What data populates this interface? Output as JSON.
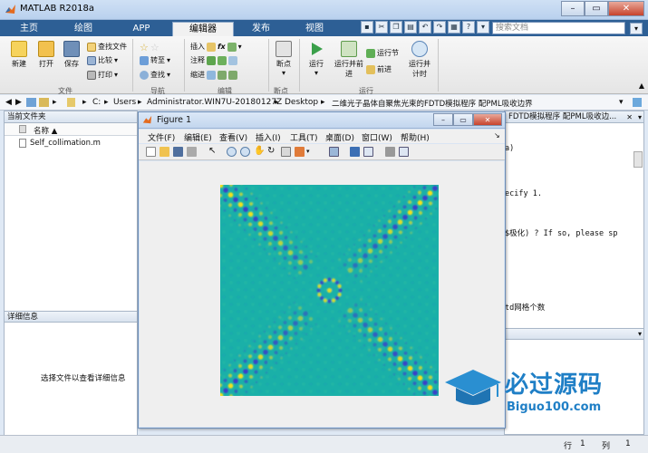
{
  "app": {
    "title": "MATLAB R2018a"
  },
  "tabs": [
    {
      "label": "主页"
    },
    {
      "label": "绘图"
    },
    {
      "label": "APP"
    },
    {
      "label": "编辑器"
    },
    {
      "label": "发布"
    },
    {
      "label": "视图"
    }
  ],
  "search": {
    "placeholder": "搜索文档"
  },
  "ribbon": {
    "file": {
      "new": "新建",
      "open": "打开",
      "save": "保存",
      "find_files": "查找文件",
      "compare": "比较",
      "print": "打印",
      "group": "文件"
    },
    "nav": {
      "goto": "转至",
      "find": "查找",
      "group": "导航"
    },
    "edit": {
      "insert": "插入",
      "comment": "注释",
      "indent": "缩进",
      "fx": "fx",
      "group": "编辑"
    },
    "breakpoints": {
      "label": "断点",
      "group": "断点"
    },
    "run": {
      "run": "运行",
      "run_advance": "运行并前进",
      "run_section": "运行节",
      "advance": "前进",
      "run_time": "运行并计时",
      "group": "运行"
    }
  },
  "address": {
    "drive": "C:",
    "users": "Users",
    "user": "Administrator.WIN7U-20180127Z",
    "desktop": "Desktop",
    "folder": "二维光子晶体自聚焦光束的FDTD模拟程序 配PML吸收边界"
  },
  "current_folder": {
    "title": "当前文件夹",
    "col_name": "名称 ▲",
    "files": [
      "Self_collimation.m"
    ]
  },
  "details": {
    "title": "详细信息",
    "hint": "选择文件以查看详细信息"
  },
  "editor_tab": {
    "title": "FDTD模拟程序 配PML吸收边..."
  },
  "editor_lines": [
    "a)",
    "ecify 1.",
    "$极化) ? If so, please sp",
    "td网格个数"
  ],
  "figure": {
    "title": "Figure 1",
    "menu": [
      "文件(F)",
      "编辑(E)",
      "查看(V)",
      "插入(I)",
      "工具(T)",
      "桌面(D)",
      "窗口(W)",
      "帮助(H)"
    ]
  },
  "status": {
    "row_label": "行",
    "row": "1",
    "col_label": "列",
    "col": "1"
  },
  "watermark": {
    "text": "必过源码",
    "sub": "Biguo100.com"
  }
}
